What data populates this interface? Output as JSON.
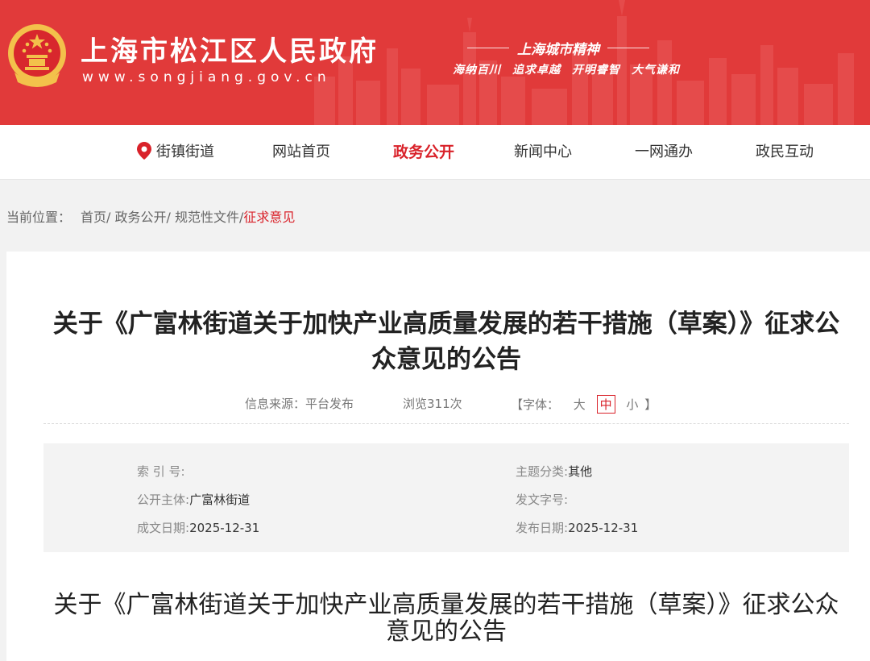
{
  "header": {
    "title": "上海市松江区人民政府",
    "url": "www.songjiang.gov.cn",
    "slogan_title": "上海城市精神",
    "slogan_items": [
      "海纳百川",
      "追求卓越",
      "开明睿智",
      "大气谦和"
    ],
    "brand_color": "#e13a3a"
  },
  "nav": {
    "items": [
      {
        "label": "街镇街道",
        "icon": "location-pin-icon"
      },
      {
        "label": "网站首页"
      },
      {
        "label": "政务公开",
        "active": true
      },
      {
        "label": "新闻中心"
      },
      {
        "label": "一网通办"
      },
      {
        "label": "政民互动"
      }
    ],
    "active_color": "#d9222a"
  },
  "breadcrumb": {
    "label": "当前位置：",
    "items": [
      "首页/",
      "政务公开/",
      "规范性文件/",
      "征求意见"
    ]
  },
  "article": {
    "title": "关于《广富林街道关于加快产业高质量发展的若干措施（草案）》征求公众意见的公告",
    "source_label": "信息来源：",
    "source_value": "平台发布",
    "views": "浏览311次",
    "font_label": "【字体：",
    "font_large": "大",
    "font_medium": "中",
    "font_small": "小",
    "font_end": "】",
    "info": {
      "index_label": "索 引 号:",
      "index_value": "",
      "topic_label": "主题分类:",
      "topic_value": "其他",
      "publisher_label": "公开主体:",
      "publisher_value": "广富林街道",
      "docno_label": "发文字号:",
      "docno_value": "",
      "created_label": "成文日期:",
      "created_value": "2025-12-31",
      "published_label": "发布日期:",
      "published_value": "2025-12-31"
    },
    "body_title": "关于《广富林街道关于加快产业高质量发展的若干措施（草案）》征求公众意见的公告"
  }
}
